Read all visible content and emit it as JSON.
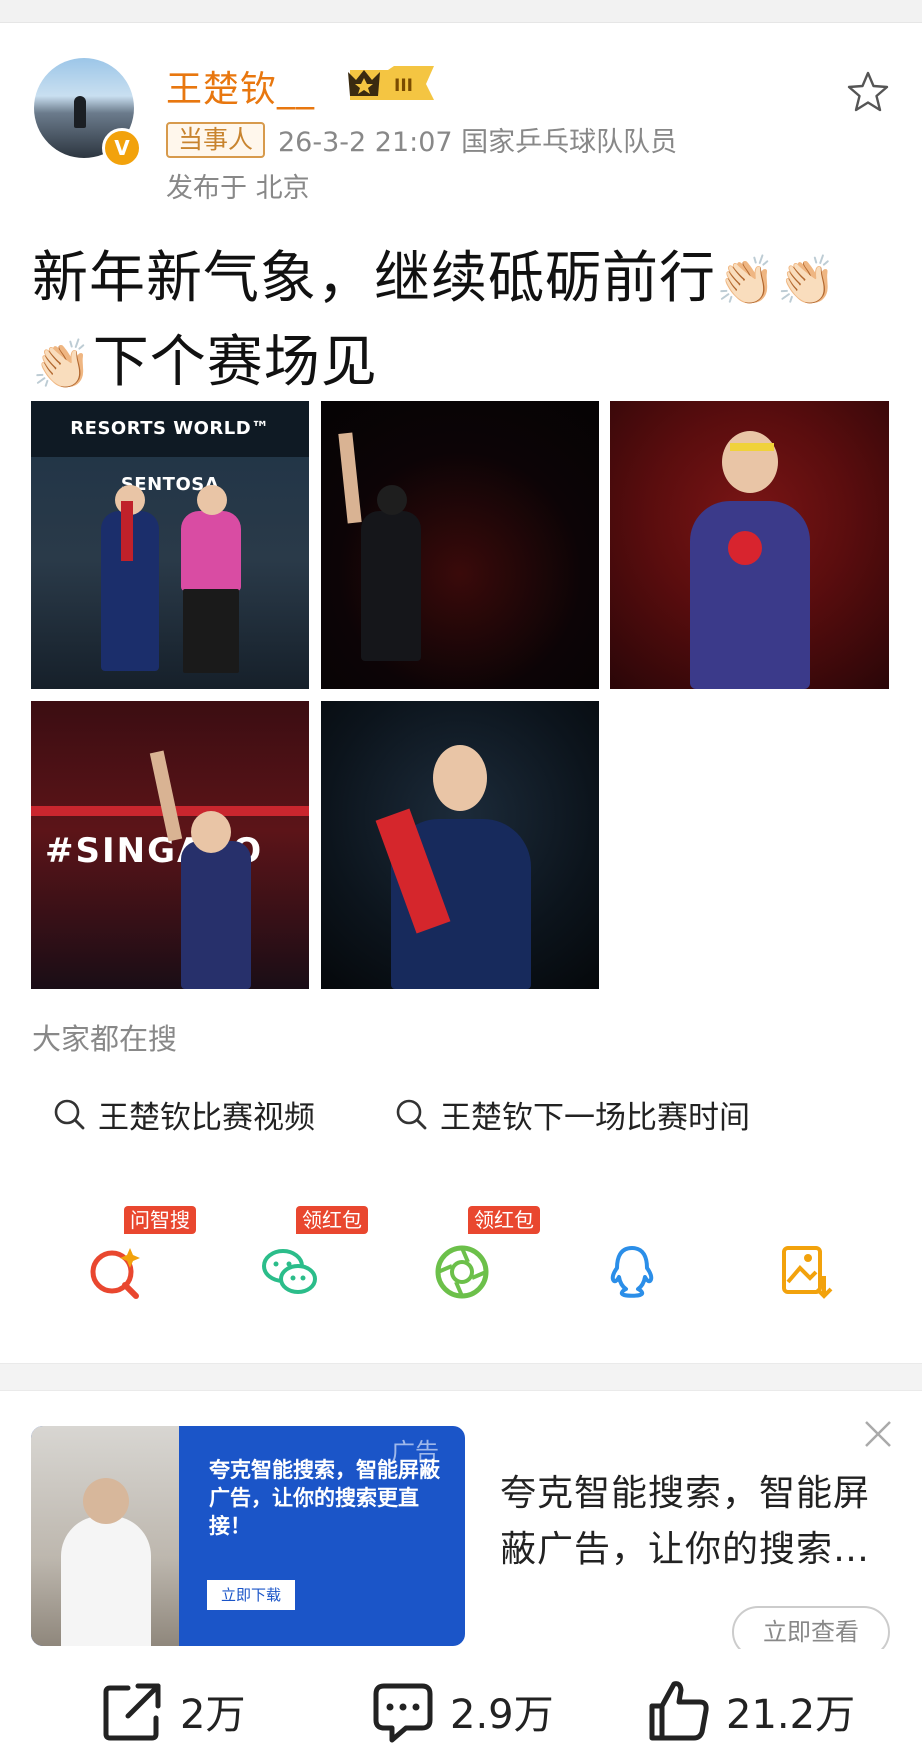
{
  "post": {
    "username": "王楚钦__",
    "level_badge": "III",
    "tag": "当事人",
    "meta": "26-3-2 21:07  国家乒乓球队队员",
    "location": "发布于 北京",
    "text_line1": "新年新气象，继续砥砺前行",
    "text_line2": "下个赛场见",
    "clap": "👏🏻",
    "images": [
      {
        "name": "trophy-ceremony",
        "banner": "RESORTS WORLD™ SENTOSA"
      },
      {
        "name": "fist-raise-dark"
      },
      {
        "name": "serve-ready"
      },
      {
        "name": "fist-raise-crowd",
        "sign": "#SINGAPO"
      },
      {
        "name": "trophy-hold"
      }
    ]
  },
  "search": {
    "title": "大家都在搜",
    "items": [
      "王楚钦比赛视频",
      "王楚钦下一场比赛时间"
    ]
  },
  "share": [
    {
      "icon": "ai-search-icon",
      "tag": "问智搜",
      "color": "#e9472f"
    },
    {
      "icon": "wechat-icon",
      "tag": "领红包",
      "color": "#2bbd8a"
    },
    {
      "icon": "moments-icon",
      "tag": "领红包",
      "color": "#6cc04a"
    },
    {
      "icon": "qq-icon",
      "tag": "",
      "color": "#2b8ee8"
    },
    {
      "icon": "save-image-icon",
      "tag": "",
      "color": "#f2a20c"
    }
  ],
  "ad": {
    "corner_label": "广告",
    "headline": "夸克智能搜索，智能屏蔽广告，让你的搜索更直接！",
    "button": "立即下载",
    "text": "夸克智能搜索，智能屏蔽广告，让你的搜索…",
    "more": "立即查看"
  },
  "actions": {
    "repost": "2万",
    "comment": "2.9万",
    "like": "21.2万"
  }
}
